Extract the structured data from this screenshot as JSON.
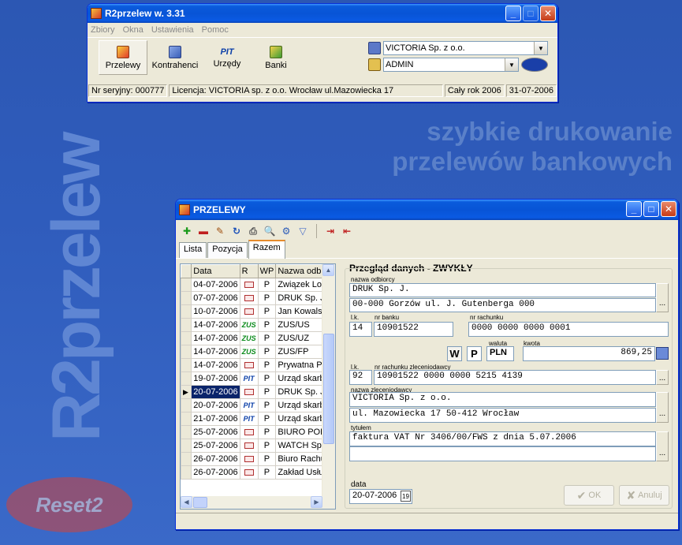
{
  "desktop": {
    "slogan_line1": "szybkie drukowanie",
    "slogan_line2": "przelewów bankowych",
    "brand": "R2przelew",
    "logo": "Reset2"
  },
  "main_window": {
    "title": "R2przelew w. 3.31",
    "menu": [
      "Zbiory",
      "Okna",
      "Ustawienia",
      "Pomoc"
    ],
    "tools": [
      {
        "label": "Przelewy",
        "icon": "transfers-icon"
      },
      {
        "label": "Kontrahenci",
        "icon": "contractors-icon"
      },
      {
        "label": "Urzędy",
        "icon": "pit-icon",
        "icon_text": "PIT"
      },
      {
        "label": "Banki",
        "icon": "banks-icon"
      }
    ],
    "company": "VICTORIA Sp. z o.o.",
    "user": "ADMIN",
    "status": {
      "serial": "Nr seryjny: 000777",
      "license": "Licencja: VICTORIA sp. z o.o. Wrocław ul.Mazowiecka 17",
      "period": "Cały rok 2006",
      "date": "31-07-2006"
    }
  },
  "przelewy": {
    "title": "PRZELEWY",
    "tabs": [
      "Lista",
      "Pozycja",
      "Razem"
    ],
    "columns": [
      "Data",
      "R",
      "WP",
      "Nazwa odbio"
    ],
    "rows": [
      {
        "date": "04-07-2006",
        "r": "env",
        "wp": "P",
        "name": "Związek Lotn"
      },
      {
        "date": "07-07-2006",
        "r": "env",
        "wp": "P",
        "name": "DRUK Sp. J."
      },
      {
        "date": "10-07-2006",
        "r": "env",
        "wp": "P",
        "name": "Jan Kowalski"
      },
      {
        "date": "14-07-2006",
        "r": "ZUS",
        "wp": "P",
        "name": "ZUS/US"
      },
      {
        "date": "14-07-2006",
        "r": "ZUS",
        "wp": "P",
        "name": "ZUS/UZ"
      },
      {
        "date": "14-07-2006",
        "r": "ZUS",
        "wp": "P",
        "name": "ZUS/FP"
      },
      {
        "date": "14-07-2006",
        "r": "env",
        "wp": "P",
        "name": "Prywatna Prz"
      },
      {
        "date": "19-07-2006",
        "r": "PIT",
        "wp": "P",
        "name": "Urząd skarbo"
      },
      {
        "date": "20-07-2006",
        "r": "env",
        "wp": "P",
        "name": "DRUK Sp. J."
      },
      {
        "date": "20-07-2006",
        "r": "PIT",
        "wp": "P",
        "name": "Urząd skarbo"
      },
      {
        "date": "21-07-2006",
        "r": "PIT",
        "wp": "P",
        "name": "Urząd skarbo"
      },
      {
        "date": "25-07-2006",
        "r": "env",
        "wp": "P",
        "name": "BIURO PODR"
      },
      {
        "date": "25-07-2006",
        "r": "env",
        "wp": "P",
        "name": "WATCH Sp."
      },
      {
        "date": "26-07-2006",
        "r": "env",
        "wp": "P",
        "name": "Biuro Rachun"
      },
      {
        "date": "26-07-2006",
        "r": "env",
        "wp": "P",
        "name": "Zakład Usłu"
      }
    ],
    "selected_row": 8,
    "detail": {
      "heading": "Przegląd danych - ZWYKŁY",
      "recipient_label": "nazwa odbiorcy",
      "recipient_line1": "DRUK Sp. J.",
      "recipient_line2": "00-000 Gorzów  ul. J. Gutenberga 000",
      "lk_label": "l.k.",
      "lk": "14",
      "bank_label": "nr banku",
      "bank": "10901522",
      "account_label": "nr rachunku",
      "account": "0000 0000 0000 0001",
      "w": "W",
      "p": "P",
      "currency_label": "waluta",
      "currency": "PLN",
      "amount_label": "kwota",
      "amount": "869,25",
      "lk2_label": "l.k.",
      "lk2": "92",
      "ordering_account_label": "nr rachunku zleceniodawcy",
      "ordering_account": "10901522 0000 0000 5215 4139",
      "ordering_label": "nazwa zleceniodawcy",
      "ordering_line1": "VICTORIA Sp. z o.o.",
      "ordering_line2": "ul. Mazowiecka 17 50-412 Wrocław",
      "title_label": "tytułem",
      "title_line1": "faktura VAT Nr 3406/00/FWS z dnia 5.07.2006",
      "title_line2": "",
      "date_label": "data",
      "date": "20-07-2006",
      "ok": "OK",
      "cancel": "Anuluj"
    }
  }
}
